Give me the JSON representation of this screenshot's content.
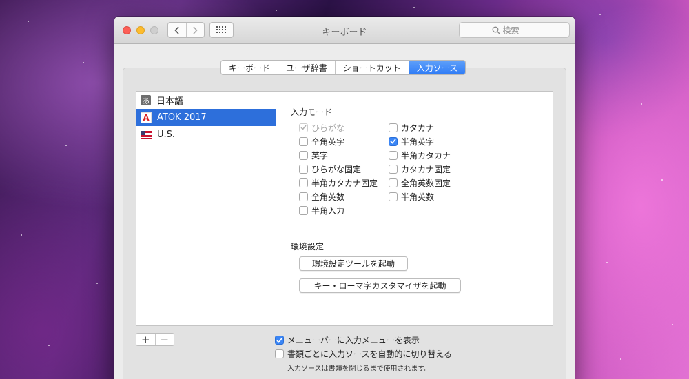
{
  "window": {
    "title": "キーボード",
    "search_placeholder": "検索"
  },
  "tabs": [
    {
      "label": "キーボード",
      "active": false
    },
    {
      "label": "ユーザ辞書",
      "active": false
    },
    {
      "label": "ショートカット",
      "active": false
    },
    {
      "label": "入力ソース",
      "active": true
    }
  ],
  "input_sources": [
    {
      "label": "日本語",
      "icon": "hiragana-a-icon",
      "icon_glyph": "あ",
      "selected": false
    },
    {
      "label": "ATOK 2017",
      "icon": "atok-icon",
      "icon_glyph": "A",
      "selected": true
    },
    {
      "label": "U.S.",
      "icon": "us-flag-icon",
      "selected": false
    }
  ],
  "input_mode": {
    "heading": "入力モード",
    "left_column": [
      {
        "label": "ひらがな",
        "checked": true,
        "disabled": true
      },
      {
        "label": "全角英字",
        "checked": false,
        "disabled": false
      },
      {
        "label": "英字",
        "checked": false,
        "disabled": false
      },
      {
        "label": "ひらがな固定",
        "checked": false,
        "disabled": false
      },
      {
        "label": "半角カタカナ固定",
        "checked": false,
        "disabled": false
      },
      {
        "label": "全角英数",
        "checked": false,
        "disabled": false
      },
      {
        "label": "半角入力",
        "checked": false,
        "disabled": false
      }
    ],
    "right_column": [
      {
        "label": "カタカナ",
        "checked": false,
        "disabled": false
      },
      {
        "label": "半角英字",
        "checked": true,
        "disabled": false
      },
      {
        "label": "半角カタカナ",
        "checked": false,
        "disabled": false
      },
      {
        "label": "カタカナ固定",
        "checked": false,
        "disabled": false
      },
      {
        "label": "全角英数固定",
        "checked": false,
        "disabled": false
      },
      {
        "label": "半角英数",
        "checked": false,
        "disabled": false
      }
    ]
  },
  "environment": {
    "heading": "環境設定",
    "open_tool_button": "環境設定ツールを起動",
    "romaji_customizer_button": "キー・ローマ字カスタマイザを起動"
  },
  "list_controls": {
    "add": "+",
    "remove": "−"
  },
  "bottom": {
    "show_menu": {
      "label": "メニューバーに入力メニューを表示",
      "checked": true
    },
    "auto_switch": {
      "label": "書類ごとに入力ソースを自動的に切り替える",
      "checked": false
    },
    "note": "入力ソースは書類を閉じるまで使用されます。"
  },
  "colors": {
    "accent": "#2f7cf6",
    "selection": "#2d6fdb",
    "close": "#fc5f57",
    "minimize": "#fdbc2e"
  }
}
